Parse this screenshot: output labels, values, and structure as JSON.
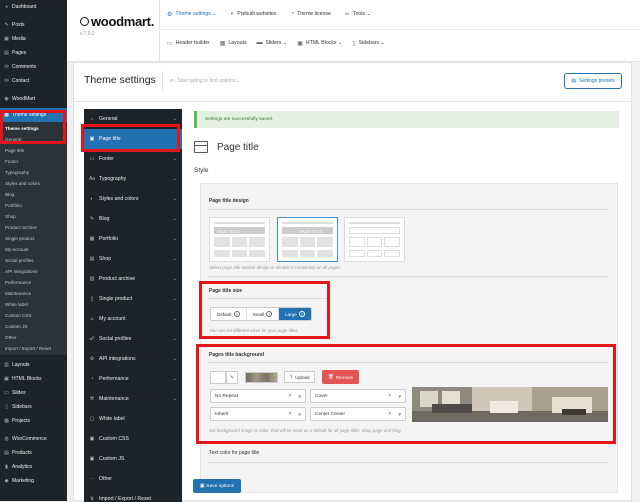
{
  "wp_menu": {
    "top_items": [
      {
        "icon": "dashboard-icon",
        "glyph": "◕",
        "label": "Dashboard"
      },
      {
        "icon": "posts-icon",
        "glyph": "✎",
        "label": "Posts"
      },
      {
        "icon": "media-icon",
        "glyph": "▣",
        "label": "Media"
      },
      {
        "icon": "pages-icon",
        "glyph": "▤",
        "label": "Pages"
      },
      {
        "icon": "comments-icon",
        "glyph": "✉",
        "label": "Comments"
      },
      {
        "icon": "contact-icon",
        "glyph": "✉",
        "label": "Contact"
      },
      {
        "icon": "woodmart-icon",
        "glyph": "◉",
        "label": "WoodMart"
      }
    ],
    "theme_settings": {
      "glyph": "▦",
      "label": "Theme settings"
    },
    "submenu": [
      "Theme settings",
      "General",
      "Page title",
      "Footer",
      "Typography",
      "Styles and colors",
      "Blog",
      "Portfolio",
      "Shop",
      "Product archive",
      "Single product",
      "My account",
      "Social profiles",
      "API integrations",
      "Performance",
      "Maintenance",
      "White label",
      "Custom CSS",
      "Custom JS",
      "Other",
      "Import / Export / Reset"
    ],
    "bottom_items": [
      {
        "icon": "layouts-icon",
        "glyph": "▥",
        "label": "Layouts"
      },
      {
        "icon": "html-blocks-icon",
        "glyph": "▣",
        "label": "HTML Blocks"
      },
      {
        "icon": "slides-icon",
        "glyph": "▭",
        "label": "Slides"
      },
      {
        "icon": "sidebars-icon",
        "glyph": "▯",
        "label": "Sidebars"
      },
      {
        "icon": "projects-icon",
        "glyph": "▦",
        "label": "Projects"
      },
      {
        "icon": "woocommerce-icon",
        "glyph": "◍",
        "label": "WooCommerce"
      },
      {
        "icon": "products-icon",
        "glyph": "▤",
        "label": "Products"
      },
      {
        "icon": "analytics-icon",
        "glyph": "▮",
        "label": "Analytics"
      },
      {
        "icon": "marketing-icon",
        "glyph": "◆",
        "label": "Marketing"
      }
    ]
  },
  "topbar": {
    "logo": "woodmart.",
    "version": "v.7.0.2",
    "nav_row1": [
      {
        "glyph": "⚙",
        "label": "Theme settings ⌄",
        "active": true
      },
      {
        "glyph": "◐",
        "label": "Prebuilt websites"
      },
      {
        "glyph": "◔",
        "label": "Theme license"
      },
      {
        "glyph": "✂",
        "label": "Tools ⌄"
      }
    ],
    "nav_row2": [
      {
        "glyph": "▭",
        "label": "Header builder"
      },
      {
        "glyph": "▦",
        "label": "Layouts"
      },
      {
        "glyph": "▬",
        "label": "Sliders ⌄"
      },
      {
        "glyph": "▣",
        "label": "HTML Blocks ⌄"
      },
      {
        "glyph": "▯",
        "label": "Sidebars ⌄"
      }
    ]
  },
  "panel": {
    "title": "Theme settings",
    "search_placeholder": "Start typing to find options...",
    "presets_label": "Settings presets",
    "nav": [
      {
        "glyph": "⌂",
        "label": "General",
        "chev": true
      },
      {
        "glyph": "▣",
        "label": "Page title",
        "active": true
      },
      {
        "glyph": "▭",
        "label": "Footer",
        "chev": true
      },
      {
        "glyph": "Aa",
        "label": "Typography",
        "chev": true
      },
      {
        "glyph": "◐",
        "label": "Styles and colors",
        "chev": true
      },
      {
        "glyph": "✎",
        "label": "Blog",
        "chev": true
      },
      {
        "glyph": "▦",
        "label": "Portfolio",
        "chev": true
      },
      {
        "glyph": "▤",
        "label": "Shop",
        "chev": true
      },
      {
        "glyph": "▥",
        "label": "Product archive",
        "chev": true
      },
      {
        "glyph": "▯",
        "label": "Single product",
        "chev": true
      },
      {
        "glyph": "☺",
        "label": "My account",
        "chev": true
      },
      {
        "glyph": "☍",
        "label": "Social profiles",
        "chev": true
      },
      {
        "glyph": "⚙",
        "label": "API integrations",
        "chev": true
      },
      {
        "glyph": "◔",
        "label": "Performance",
        "chev": true
      },
      {
        "glyph": "⚒",
        "label": "Maintenance",
        "chev": true
      },
      {
        "glyph": "▢",
        "label": "White label"
      },
      {
        "glyph": "▣",
        "label": "Custom CSS"
      },
      {
        "glyph": "▣",
        "label": "Custom JS"
      },
      {
        "glyph": "⋯",
        "label": "Other"
      },
      {
        "glyph": "⇅",
        "label": "Import / Export / Reset"
      }
    ]
  },
  "content": {
    "notice": "Settings are successfully saved.",
    "section_title": "Page title",
    "style_heading": "Style",
    "design_label": "Page title design",
    "design_thumb_text": "PAGE TITLE",
    "design_desc": "Select page title section design or disable it completely on all pages.",
    "size_label": "Page title size",
    "size_options": [
      {
        "label": "Default",
        "active": false
      },
      {
        "label": "Small",
        "active": false
      },
      {
        "label": "Large",
        "active": true
      }
    ],
    "size_desc": "You can set different sizes for your page titles.",
    "bg_label": "Pages title background",
    "upload_label": "Upload",
    "remove_label": "Remove",
    "repeat_value": "No Repeat",
    "size_value": "Cover",
    "attach_value": "Inherit",
    "position_value": "Center Center",
    "bg_desc": "Set background image or color, that will be used as a default for all page titles, shop page and blog.",
    "text_color_label": "Text color for page title",
    "save_label": "Save options"
  },
  "colors": {
    "accent": "#2271b1",
    "highlight": "#e3141b",
    "remove": "#e45454"
  }
}
